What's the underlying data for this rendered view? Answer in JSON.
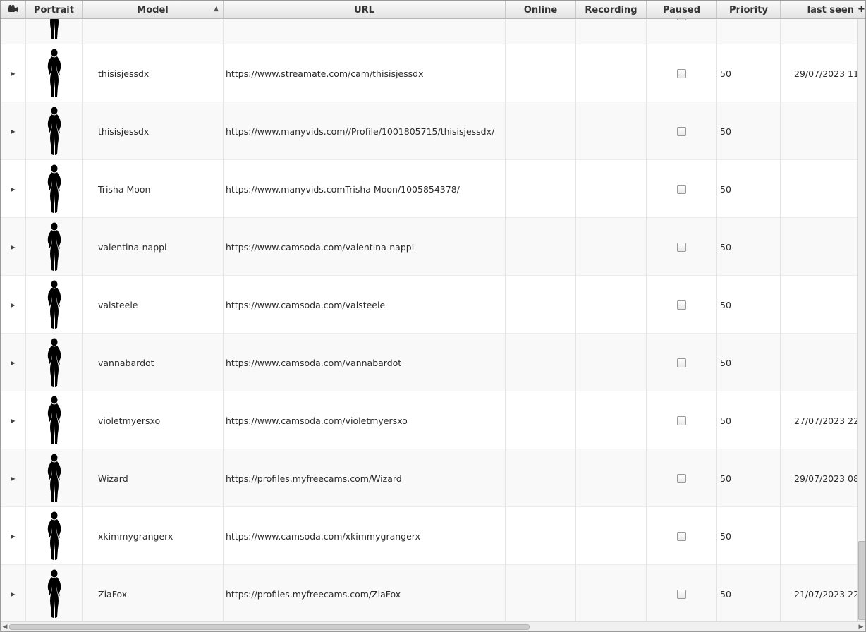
{
  "columns": {
    "camera_icon": "camera-icon",
    "portrait": "Portrait",
    "model": "Model",
    "url": "URL",
    "online": "Online",
    "recording": "Recording",
    "paused": "Paused",
    "priority": "Priority",
    "last_seen": "last seen",
    "column_menu": "+"
  },
  "sort": {
    "column": "model",
    "direction": "ascending"
  },
  "rows": [
    {
      "model": "",
      "url": "",
      "paused": false,
      "priority": "",
      "last_seen": "",
      "partial": true
    },
    {
      "model": "thisisjessdx",
      "url": "https://www.streamate.com/cam/thisisjessdx",
      "paused": false,
      "priority": "50",
      "last_seen": "29/07/2023 11"
    },
    {
      "model": "thisisjessdx",
      "url": "https://www.manyvids.com//Profile/1001805715/thisisjessdx/",
      "paused": false,
      "priority": "50",
      "last_seen": ""
    },
    {
      "model": "Trisha Moon",
      "url": "https://www.manyvids.comTrisha Moon/1005854378/",
      "paused": false,
      "priority": "50",
      "last_seen": ""
    },
    {
      "model": "valentina-nappi",
      "url": "https://www.camsoda.com/valentina-nappi",
      "paused": false,
      "priority": "50",
      "last_seen": ""
    },
    {
      "model": "valsteele",
      "url": "https://www.camsoda.com/valsteele",
      "paused": false,
      "priority": "50",
      "last_seen": ""
    },
    {
      "model": "vannabardot",
      "url": "https://www.camsoda.com/vannabardot",
      "paused": false,
      "priority": "50",
      "last_seen": ""
    },
    {
      "model": "violetmyersxo",
      "url": "https://www.camsoda.com/violetmyersxo",
      "paused": false,
      "priority": "50",
      "last_seen": "27/07/2023 22"
    },
    {
      "model": "Wizard",
      "url": "https://profiles.myfreecams.com/Wizard",
      "paused": false,
      "priority": "50",
      "last_seen": "29/07/2023 08"
    },
    {
      "model": "xkimmygrangerx",
      "url": "https://www.camsoda.com/xkimmygrangerx",
      "paused": false,
      "priority": "50",
      "last_seen": ""
    },
    {
      "model": "ZiaFox",
      "url": "https://profiles.myfreecams.com/ZiaFox",
      "paused": false,
      "priority": "50",
      "last_seen": "21/07/2023 22"
    }
  ]
}
